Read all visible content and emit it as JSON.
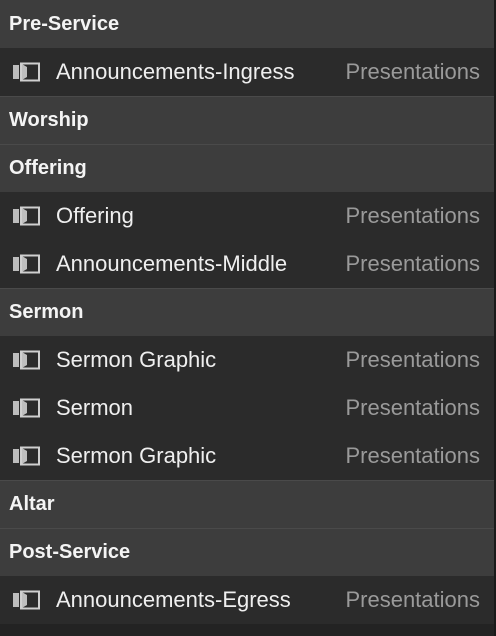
{
  "colors": {
    "background": "#232323",
    "header_bg": "#3d3d3d",
    "item_bg": "#2b2b2b",
    "header_text": "#f4f4f4",
    "item_text": "#efefef",
    "type_text": "#9a9a9a"
  },
  "sections": [
    {
      "header": "Pre-Service",
      "items": [
        {
          "icon": "presentation-icon",
          "title": "Announcements-Ingress",
          "type": "Presentations"
        }
      ]
    },
    {
      "header": "Worship",
      "items": []
    },
    {
      "header": "Offering",
      "items": [
        {
          "icon": "presentation-icon",
          "title": "Offering",
          "type": "Presentations"
        },
        {
          "icon": "presentation-icon",
          "title": "Announcements-Middle",
          "type": "Presentations"
        }
      ]
    },
    {
      "header": "Sermon",
      "items": [
        {
          "icon": "presentation-icon",
          "title": "Sermon Graphic",
          "type": "Presentations"
        },
        {
          "icon": "presentation-icon",
          "title": "Sermon",
          "type": "Presentations"
        },
        {
          "icon": "presentation-icon",
          "title": "Sermon Graphic",
          "type": "Presentations"
        }
      ]
    },
    {
      "header": "Altar",
      "items": []
    },
    {
      "header": "Post-Service",
      "items": [
        {
          "icon": "presentation-icon",
          "title": "Announcements-Egress",
          "type": "Presentations"
        }
      ]
    }
  ]
}
